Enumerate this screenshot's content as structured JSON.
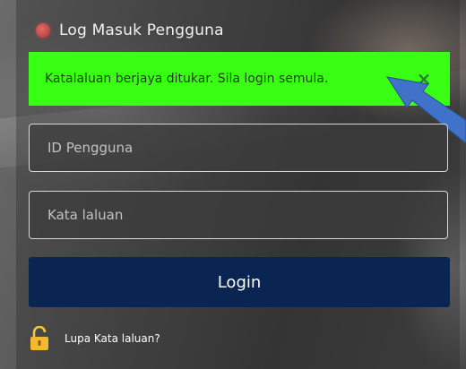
{
  "header": {
    "title": "Log Masuk Pengguna",
    "icon": "red-dot-icon"
  },
  "alert": {
    "message": "Katalaluan berjaya ditukar. Sila login semula.",
    "close_symbol": "×",
    "background_color": "#39ff14"
  },
  "form": {
    "user_id_placeholder": "ID Pengguna",
    "password_placeholder": "Kata laluan",
    "login_label": "Login",
    "login_button_color": "#0b2552"
  },
  "footer": {
    "forgot_password_label": "Lupa Kata laluan?",
    "lock_icon": "unlocked-padlock-icon"
  },
  "annotation": {
    "arrow_color": "#3f72c8",
    "icon": "pointer-arrow-icon"
  }
}
